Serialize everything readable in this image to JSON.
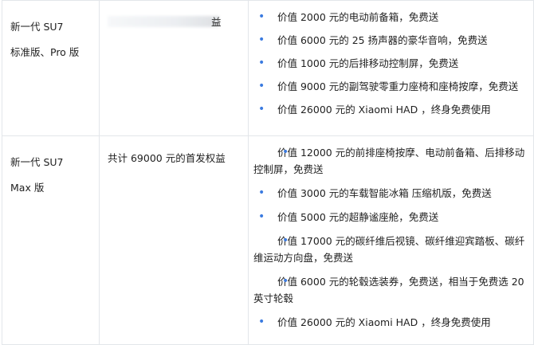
{
  "rows": [
    {
      "model_line1": "新一代 SU7",
      "model_line2": "标准版、Pro 版",
      "benefit_visible_end": "益",
      "items": [
        "价值 2000 元的电动前备箱，免费送",
        "价值 6000 元的 25 扬声器的豪华音响，免费送",
        "价值 1000 元的后排移动控制屏，免费送",
        "价值 9000 元的副驾驶零重力座椅和座椅按摩，免费送",
        "价值 26000 元的 Xiaomi HAD ，终身免费使用"
      ]
    },
    {
      "model_line1": "新一代 SU7",
      "model_line2": "Max 版",
      "benefit": "共计 69000 元的首发权益",
      "items": [
        "价值 12000 元的前排座椅按摩、电动前备箱、后排移动控制屏，免费送",
        "价值 3000 元的车载智能冰箱 压缩机版，免费送",
        "价值 5000 元的超静谧座舱，免费送",
        "价值 17000 元的碳纤维后视镜、碳纤维迎宾踏板、碳纤维运动方向盘，免费送",
        "价值 6000 元的轮毂选装券，免费送，相当于免费选 20 英寸轮毂",
        "价值 26000 元的 Xiaomi HAD ，终身免费使用"
      ]
    }
  ],
  "bullet_color": "#3b7be0",
  "bullet_icon": "bullet-dot"
}
